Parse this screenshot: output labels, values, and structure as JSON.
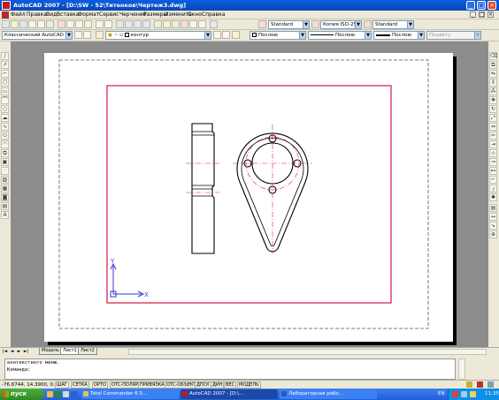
{
  "window": {
    "title": "AutoCAD 2007 - [D:\\SW - 52\\Титенков\\Чертеж3.dwg]",
    "min": "_",
    "restore": "□",
    "close": "×"
  },
  "menu": {
    "items": [
      "Файл",
      "Правка",
      "Вид",
      "Вставка",
      "Формат",
      "Сервис",
      "Черчение",
      "Размеры",
      "Изменить",
      "Окно",
      "Справка"
    ],
    "mdi": [
      "_",
      "□",
      "×"
    ]
  },
  "toolbar1": {
    "text_style": "Standard",
    "dim_style": "Копия ISO-25",
    "table_style": "Standard"
  },
  "toolbar2": {
    "workspace": "Классический AutoCAD",
    "layer": "контур",
    "color": "Послою",
    "linetype": "Послою",
    "lineweight": "Послою",
    "plot_style": "Поцвету"
  },
  "layout_tabs": {
    "nav": [
      "|◄",
      "◄",
      "►",
      "►|"
    ],
    "tabs": [
      "Модель",
      "Лист1",
      "Лист2"
    ],
    "active": "Лист1"
  },
  "command": {
    "lines": [
      "контекстного меню.",
      "Команда:"
    ]
  },
  "statusbar": {
    "coords": "-76.6744, 14.3900, 0.0000",
    "modes": [
      "ШАГ",
      "СЕТКА",
      "ОРТО",
      "ОТС-ПОЛЯР",
      "ПРИВЯЗКА",
      "ОТС-ОБЪЕКТ",
      "ДПСК",
      "ДИН",
      "ВЕС",
      "МОДЕЛЬ"
    ]
  },
  "drawing": {
    "ucs_y": "Y",
    "ucs_x": "X",
    "frame_color": "#d01844",
    "centerline_color": "#e0204c"
  },
  "taskbar": {
    "start": "пуск",
    "tasks": [
      "Total Commander 6.5...",
      "AutoCAD 2007 - [D:\\...",
      "Лабораторная рабо..."
    ],
    "lang": "EN",
    "clock": "11:35"
  },
  "colors": {
    "titlebar": "#0a5fe0",
    "canvas": "#8c8c8c",
    "sheet": "#ffffff",
    "taskbar": "#245edb",
    "start": "#2f8a24"
  }
}
